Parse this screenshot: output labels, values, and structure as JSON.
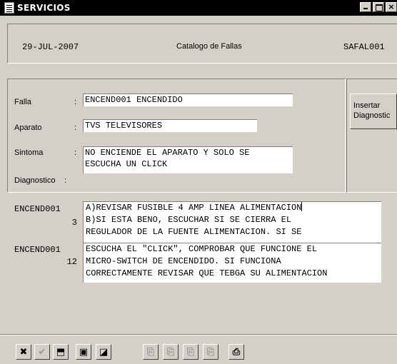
{
  "window": {
    "title": "SERVICIOS"
  },
  "header": {
    "date": "29-JUL-2007",
    "title": "Catalogo de Fallas",
    "code": "SAFAL001"
  },
  "form": {
    "falla": {
      "label": "Falla",
      "colon": ":",
      "code": "ENCEND001",
      "name": "ENCENDIDO"
    },
    "aparato": {
      "label": "Aparato",
      "colon": ":",
      "code": "TVS",
      "name": "TELEVISORES"
    },
    "sintoma": {
      "label": "Sintoma",
      "colon": ":",
      "lines": [
        "NO ENCIENDE EL APARATO Y SOLO SE",
        "ESCUCHA UN CLICK"
      ]
    },
    "diagnostico": {
      "label": "Diagnostico",
      "colon": ":"
    }
  },
  "insert_button": {
    "line1": "Insertar",
    "line2": "Diagnostic"
  },
  "diagnostics": [
    {
      "code": "ENCEND001",
      "number": "3",
      "lines": [
        "A)REVISAR FUSIBLE 4 AMP LINEA ALIMENTACION",
        "B)SI ESTA BENO, ESCUCHAR SI SE CIERRA EL",
        "REGULADOR DE LA FUENTE ALIMENTACION. SI SE"
      ]
    },
    {
      "code": "ENCEND001",
      "number": "12",
      "lines": [
        "ESCUCHA EL \"CLICK\", COMPROBAR QUE FUNCIONE EL",
        "MICRO-SWITCH DE ENCENDIDO. SI FUNCIONA",
        "CORRECTAMENTE REVISAR QUE TEBGA SU ALIMENTACION"
      ]
    }
  ],
  "toolbar": {
    "buttons": [
      {
        "icon": "cancel-x-icon",
        "glyph": "✖"
      },
      {
        "icon": "check-icon",
        "glyph": "✔"
      },
      {
        "icon": "undo-icon",
        "glyph": "⬒"
      },
      {
        "icon": "save-disk-icon",
        "glyph": "▣"
      },
      {
        "icon": "exit-icon",
        "glyph": "◪"
      },
      {
        "icon": "insert-record-icon",
        "glyph": "⎘"
      },
      {
        "icon": "delete-record-icon",
        "glyph": "⎘"
      },
      {
        "icon": "previous-record-icon",
        "glyph": "⎘"
      },
      {
        "icon": "next-record-icon",
        "glyph": "⎘"
      },
      {
        "icon": "printer-icon",
        "glyph": "⎙"
      }
    ]
  }
}
